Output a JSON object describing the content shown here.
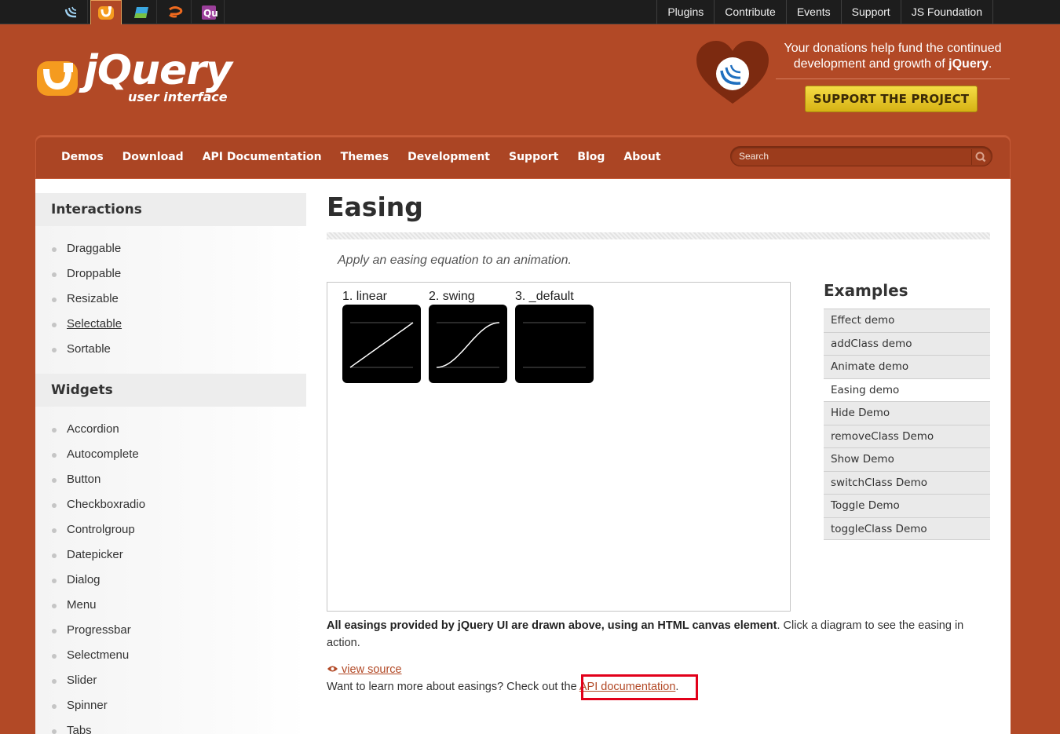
{
  "globalbar": {
    "projects": [
      {
        "name": "jquery-icon",
        "color": "#9fd0f0"
      },
      {
        "name": "jquery-ui-icon",
        "color": "#f59b1f"
      },
      {
        "name": "jquery-mobile-icon",
        "color": "#3ba7e0"
      },
      {
        "name": "sizzle-icon",
        "color": "#f06a1e"
      },
      {
        "name": "qunit-icon",
        "color": "#9b3f9a"
      }
    ],
    "links": [
      "Plugins",
      "Contribute",
      "Events",
      "Support",
      "JS Foundation"
    ]
  },
  "logo": {
    "main": "jQuery",
    "sub": "user interface"
  },
  "donation": {
    "text_before": "Your donations help fund the continued development and growth of ",
    "text_bold": "jQuery",
    "text_after": ".",
    "button": "SUPPORT THE PROJECT"
  },
  "nav": {
    "links": [
      "Demos",
      "Download",
      "API Documentation",
      "Themes",
      "Development",
      "Support",
      "Blog",
      "About"
    ],
    "search_placeholder": "Search"
  },
  "sidebar": {
    "interactions_title": "Interactions",
    "interactions": [
      "Draggable",
      "Droppable",
      "Resizable",
      "Selectable",
      "Sortable"
    ],
    "widgets_title": "Widgets",
    "widgets": [
      "Accordion",
      "Autocomplete",
      "Button",
      "Checkboxradio",
      "Controlgroup",
      "Datepicker",
      "Dialog",
      "Menu",
      "Progressbar",
      "Selectmenu",
      "Slider",
      "Spinner",
      "Tabs"
    ]
  },
  "main": {
    "title": "Easing",
    "description": "Apply an easing equation to an animation.",
    "graphs": [
      {
        "label": "1. linear",
        "easing": "linear"
      },
      {
        "label": "2. swing",
        "easing": "swing"
      },
      {
        "label": "3. _default",
        "easing": "none"
      }
    ],
    "body_bold": "All easings provided by jQuery UI are drawn above, using an HTML canvas element",
    "body_rest": ". Click a diagram to see the easing in action.",
    "view_source": "view source",
    "learn_before": "Want to learn more about easings? Check out the ",
    "learn_link": "API documentation",
    "learn_after": "."
  },
  "examples": {
    "title": "Examples",
    "items": [
      "Effect demo",
      "addClass demo",
      "Animate demo",
      "Easing demo",
      "Hide Demo",
      "removeClass Demo",
      "Show Demo",
      "switchClass Demo",
      "Toggle Demo",
      "toggleClass Demo"
    ],
    "active_index": 3
  }
}
